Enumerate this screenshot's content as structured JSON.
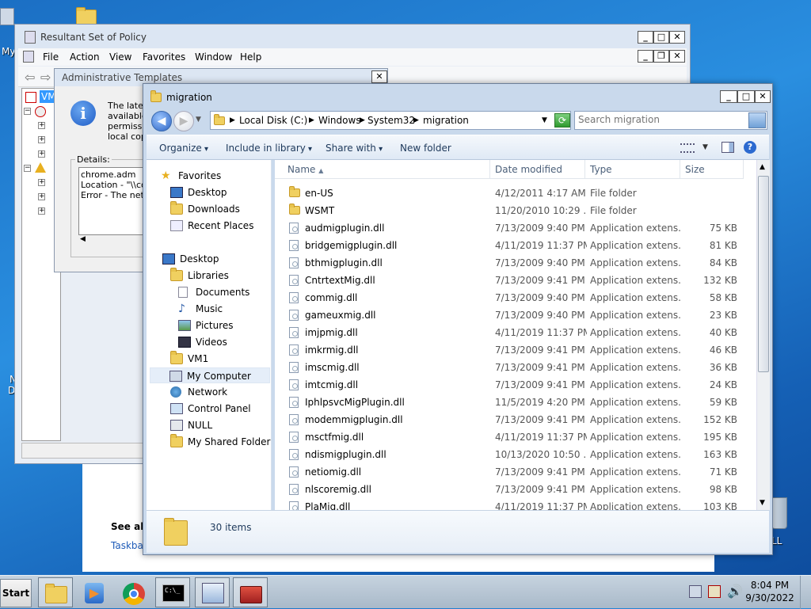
{
  "desktop": {
    "icon_labels": [
      "My",
      "N",
      "D",
      "LL"
    ]
  },
  "rsop_window": {
    "title": "Resultant Set of Policy",
    "menu": [
      "File",
      "Action",
      "View",
      "Favorites",
      "Window",
      "Help"
    ],
    "tree_first_item": "VM"
  },
  "admin_templates": {
    "title": "Administrative Templates",
    "message_lines": [
      "The lates",
      "available",
      "permissic",
      "local cop"
    ],
    "details_label": "Details:",
    "details_lines": [
      "chrome.adm",
      "Location - \"\\\\col",
      "Error - The netv"
    ]
  },
  "background_window": {
    "see_also": "See als",
    "link": "Taskba"
  },
  "explorer": {
    "title": "migration",
    "breadcrumbs": [
      "Local Disk (C:)",
      "Windows",
      "System32",
      "migration"
    ],
    "search_placeholder": "Search migration",
    "commands": {
      "organize": "Organize",
      "include": "Include in library",
      "share": "Share with",
      "new_folder": "New folder"
    },
    "nav": {
      "favorites": "Favorites",
      "desktop_fav": "Desktop",
      "downloads": "Downloads",
      "recent": "Recent Places",
      "desktop": "Desktop",
      "libraries": "Libraries",
      "documents": "Documents",
      "music": "Music",
      "pictures": "Pictures",
      "videos": "Videos",
      "vm1": "VM1",
      "my_computer": "My Computer",
      "network": "Network",
      "control_panel": "Control Panel",
      "null": "NULL",
      "shared": "My Shared Folder"
    },
    "columns": {
      "name": "Name",
      "date": "Date modified",
      "type": "Type",
      "size": "Size"
    },
    "files": [
      {
        "name": "en-US",
        "date": "4/12/2011 4:17 AM",
        "type": "File folder",
        "size": "",
        "kind": "folder"
      },
      {
        "name": "WSMT",
        "date": "11/20/2010 10:29 ...",
        "type": "File folder",
        "size": "",
        "kind": "folder"
      },
      {
        "name": "audmigplugin.dll",
        "date": "7/13/2009 9:40 PM",
        "type": "Application extens...",
        "size": "75 KB",
        "kind": "file"
      },
      {
        "name": "bridgemigplugin.dll",
        "date": "4/11/2019 11:37 PM",
        "type": "Application extens...",
        "size": "81 KB",
        "kind": "file"
      },
      {
        "name": "bthmigplugin.dll",
        "date": "7/13/2009 9:40 PM",
        "type": "Application extens...",
        "size": "84 KB",
        "kind": "file"
      },
      {
        "name": "CntrtextMig.dll",
        "date": "7/13/2009 9:41 PM",
        "type": "Application extens...",
        "size": "132 KB",
        "kind": "file"
      },
      {
        "name": "commig.dll",
        "date": "7/13/2009 9:40 PM",
        "type": "Application extens...",
        "size": "58 KB",
        "kind": "file"
      },
      {
        "name": "gameuxmig.dll",
        "date": "7/13/2009 9:40 PM",
        "type": "Application extens...",
        "size": "23 KB",
        "kind": "file"
      },
      {
        "name": "imjpmig.dll",
        "date": "4/11/2019 11:37 PM",
        "type": "Application extens...",
        "size": "40 KB",
        "kind": "file"
      },
      {
        "name": "imkrmig.dll",
        "date": "7/13/2009 9:41 PM",
        "type": "Application extens...",
        "size": "46 KB",
        "kind": "file"
      },
      {
        "name": "imscmig.dll",
        "date": "7/13/2009 9:41 PM",
        "type": "Application extens...",
        "size": "36 KB",
        "kind": "file"
      },
      {
        "name": "imtcmig.dll",
        "date": "7/13/2009 9:41 PM",
        "type": "Application extens...",
        "size": "24 KB",
        "kind": "file"
      },
      {
        "name": "IphlpsvcMigPlugin.dll",
        "date": "11/5/2019 4:20 PM",
        "type": "Application extens...",
        "size": "59 KB",
        "kind": "file"
      },
      {
        "name": "modemmigplugin.dll",
        "date": "7/13/2009 9:41 PM",
        "type": "Application extens...",
        "size": "152 KB",
        "kind": "file"
      },
      {
        "name": "msctfmig.dll",
        "date": "4/11/2019 11:37 PM",
        "type": "Application extens...",
        "size": "195 KB",
        "kind": "file"
      },
      {
        "name": "ndismigplugin.dll",
        "date": "10/13/2020 10:50 ...",
        "type": "Application extens...",
        "size": "163 KB",
        "kind": "file"
      },
      {
        "name": "netiomig.dll",
        "date": "7/13/2009 9:41 PM",
        "type": "Application extens...",
        "size": "71 KB",
        "kind": "file"
      },
      {
        "name": "nlscoremig.dll",
        "date": "7/13/2009 9:41 PM",
        "type": "Application extens...",
        "size": "98 KB",
        "kind": "file"
      },
      {
        "name": "PlaMig.dll",
        "date": "4/11/2019 11:37 PM",
        "type": "Application extens...",
        "size": "103 KB",
        "kind": "file"
      }
    ],
    "item_count": "30 items"
  },
  "taskbar": {
    "start": "Start",
    "time": "8:04 PM",
    "date": "9/30/2022",
    "apps": [
      "explorer-icon",
      "media-player-icon",
      "chrome-icon",
      "cmd-icon",
      "rsop-icon",
      "toolbox-icon"
    ]
  }
}
